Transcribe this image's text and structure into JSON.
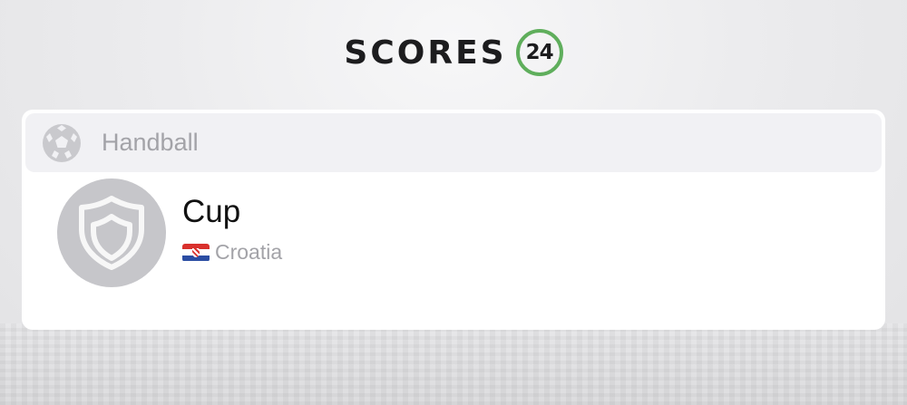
{
  "brand": {
    "name": "SCORES",
    "badge": "24",
    "badge_color": "#5fae5c"
  },
  "header": {
    "sport_icon": "handball-icon",
    "sport_label": "Handball"
  },
  "tournament": {
    "logo_icon": "shield-icon",
    "name": "Cup",
    "country_flag_icon": "croatia-flag-icon",
    "country": "Croatia"
  }
}
